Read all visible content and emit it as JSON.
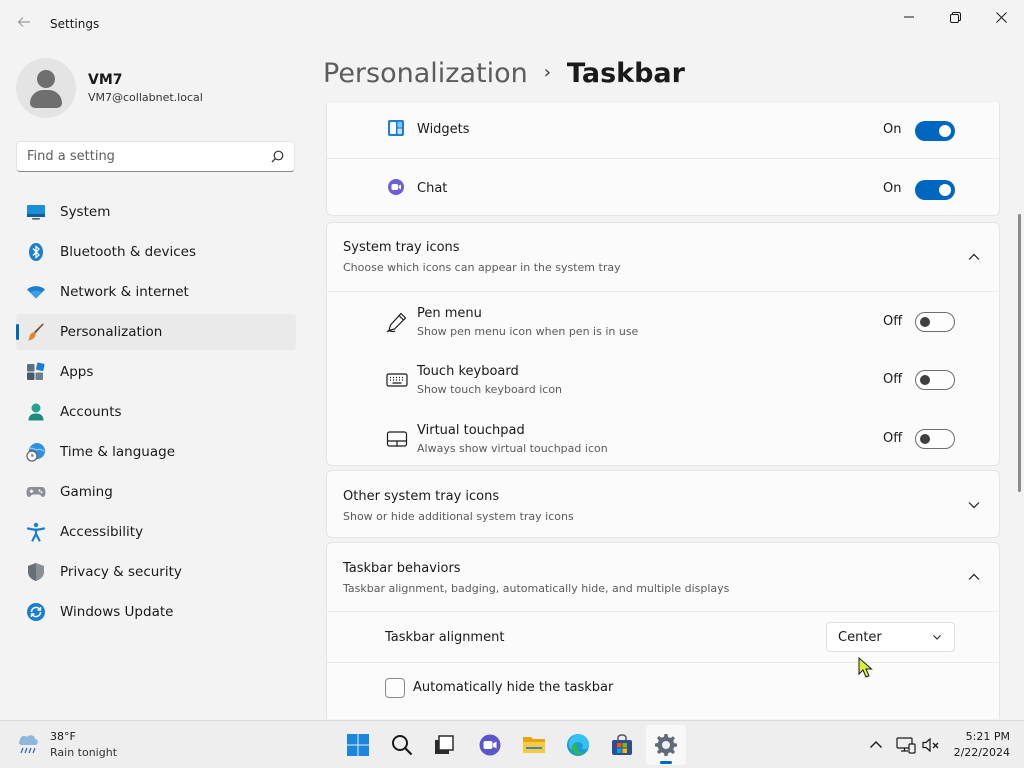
{
  "window": {
    "title": "Settings"
  },
  "profile": {
    "name": "VM7",
    "email": "VM7@collabnet.local"
  },
  "search": {
    "placeholder": "Find a setting"
  },
  "sidebar": {
    "items": [
      {
        "label": "System",
        "icon": "system-icon"
      },
      {
        "label": "Bluetooth & devices",
        "icon": "bluetooth-icon"
      },
      {
        "label": "Network & internet",
        "icon": "wifi-icon"
      },
      {
        "label": "Personalization",
        "icon": "brush-icon",
        "active": true
      },
      {
        "label": "Apps",
        "icon": "apps-icon"
      },
      {
        "label": "Accounts",
        "icon": "accounts-icon"
      },
      {
        "label": "Time & language",
        "icon": "globe-clock-icon"
      },
      {
        "label": "Gaming",
        "icon": "gamepad-icon"
      },
      {
        "label": "Accessibility",
        "icon": "accessibility-icon"
      },
      {
        "label": "Privacy & security",
        "icon": "shield-icon"
      },
      {
        "label": "Windows Update",
        "icon": "update-icon"
      }
    ]
  },
  "breadcrumb": {
    "parent": "Personalization",
    "separator": "›",
    "current": "Taskbar"
  },
  "taskbar_items": {
    "widgets": {
      "label": "Widgets",
      "state": "On"
    },
    "chat": {
      "label": "Chat",
      "state": "On"
    }
  },
  "system_tray": {
    "title": "System tray icons",
    "subtitle": "Choose which icons can appear in the system tray",
    "items": [
      {
        "label": "Pen menu",
        "desc": "Show pen menu icon when pen is in use",
        "state": "Off"
      },
      {
        "label": "Touch keyboard",
        "desc": "Show touch keyboard icon",
        "state": "Off"
      },
      {
        "label": "Virtual touchpad",
        "desc": "Always show virtual touchpad icon",
        "state": "Off"
      }
    ]
  },
  "other_tray": {
    "title": "Other system tray icons",
    "subtitle": "Show or hide additional system tray icons"
  },
  "behaviors": {
    "title": "Taskbar behaviors",
    "subtitle": "Taskbar alignment, badging, automatically hide, and multiple displays",
    "alignment_label": "Taskbar alignment",
    "alignment_value": "Center",
    "autohide_label": "Automatically hide the taskbar"
  },
  "taskbar": {
    "weather_temp": "38°F",
    "weather_desc": "Rain tonight",
    "time": "5:21 PM",
    "date": "2/22/2024"
  },
  "colors": {
    "accent": "#0067c0",
    "background": "#f3f3f3",
    "card": "#fbfbfb"
  }
}
